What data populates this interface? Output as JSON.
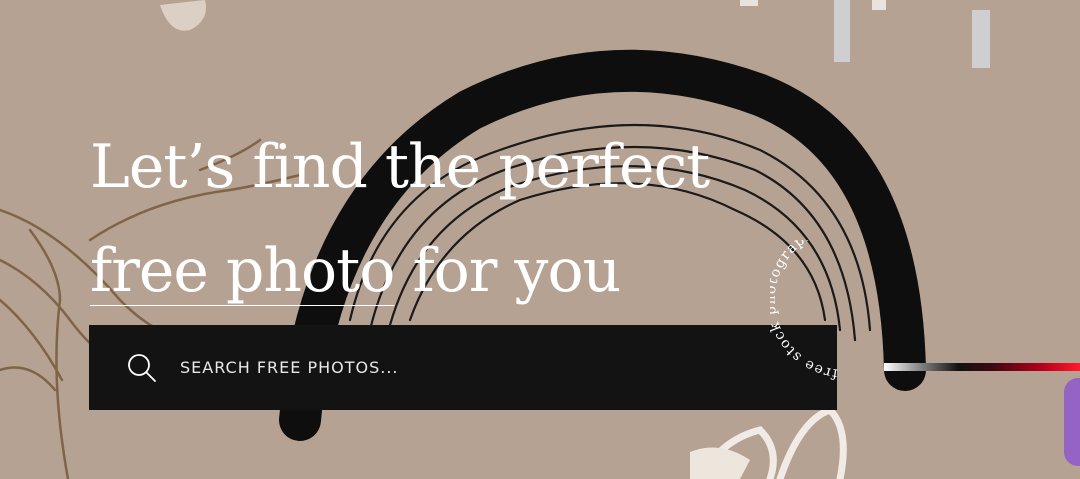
{
  "hero": {
    "headline_part1": "Let’s find the perfect",
    "headline_underlined": "free photo",
    "headline_part2": " for you"
  },
  "search": {
    "placeholder": "SEARCH FREE PHOTOS...",
    "value": ""
  },
  "badge": {
    "text": "free stock photography"
  },
  "colors": {
    "background": "#b6a292",
    "search_bar": "#131313",
    "text": "#ffffff",
    "accent_red": "#ff1a2a",
    "purple": "#9563c4"
  }
}
